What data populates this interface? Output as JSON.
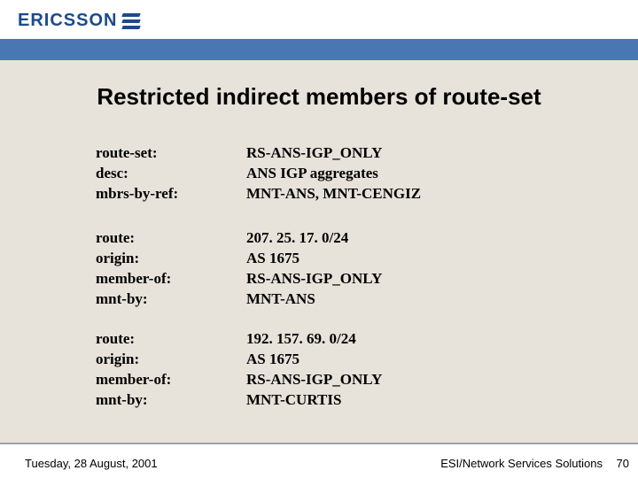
{
  "logo_text": "ERICSSON",
  "title": "Restricted indirect members of route-set",
  "blocks": [
    {
      "rows": [
        {
          "label": "route-set:",
          "value": "RS-ANS-IGP_ONLY"
        },
        {
          "label": "desc:",
          "value": "ANS IGP aggregates"
        },
        {
          "label": "mbrs-by-ref:",
          "value": "MNT-ANS, MNT-CENGIZ"
        }
      ]
    },
    {
      "rows": [
        {
          "label": "route:",
          "value": "207. 25. 17. 0/24"
        },
        {
          "label": "origin:",
          "value": "AS 1675"
        },
        {
          "label": "member-of:",
          "value": "RS-ANS-IGP_ONLY"
        },
        {
          "label": "mnt-by:",
          "value": "MNT-ANS"
        }
      ]
    },
    {
      "rows": [
        {
          "label": "route:",
          "value": "192. 157. 69. 0/24"
        },
        {
          "label": "origin:",
          "value": "AS 1675"
        },
        {
          "label": "member-of:",
          "value": "RS-ANS-IGP_ONLY"
        },
        {
          "label": "mnt-by:",
          "value": "MNT-CURTIS"
        }
      ]
    }
  ],
  "footer": {
    "date": "Tuesday, 28 August, 2001",
    "org": "ESI/Network Services Solutions",
    "page": "70"
  }
}
